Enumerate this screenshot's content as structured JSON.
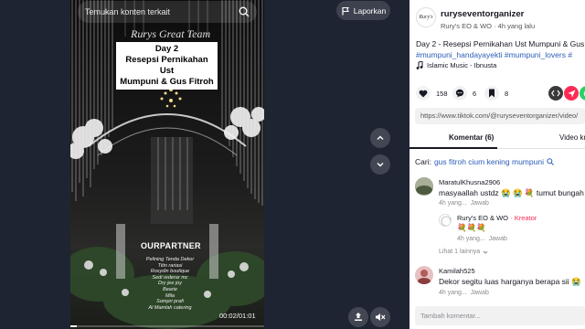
{
  "search": {
    "placeholder": "Temukan konten terkait"
  },
  "report": {
    "label": "Laporkan"
  },
  "video": {
    "brand_overlay": "Rurys Great Team",
    "caption_lines": [
      "Day 2",
      "Resepsi Pernikahan Ust",
      "Mumpuni & Gus Fitroh"
    ],
    "partner_title": "OURPARTNER",
    "partner_credits": [
      "Pelining Tenda Dekor",
      "Titin rariasi",
      "Rosydin boutique",
      "Sedi rederar mc",
      "Dry jee joy",
      "Bearie",
      "Mila",
      "Sompri prafi",
      "Al Mamlah catering"
    ],
    "timecode": "00:02/01:01",
    "progress": 0.033
  },
  "author": {
    "avatar_text": "Rury's",
    "username": "ruryseventorganizer",
    "display_line": "Rury's EO & WO · 4h yang lalu"
  },
  "post": {
    "description": "Day 2 - Resepsi Pernikahan Ust Mumpuni & Gus Fitroh",
    "hashtags": "#mumpuni_handayayekti #mumpuni_lovers #",
    "music": "Islamic Music - Ibnusta"
  },
  "stats": {
    "likes": "158",
    "comments": "6",
    "saves": "8"
  },
  "share_link": "https://www.tiktok.com/@ruryseventorganizer/video/",
  "tabs": [
    {
      "label": "Komentar (6)"
    },
    {
      "label": "Video kreator"
    }
  ],
  "related_search": {
    "prefix": "Cari:",
    "query": "gus fitroh cium kening mumpuni"
  },
  "comments": [
    {
      "name": "MaratulKhusna2906",
      "text": "masyaallah ustdz 😭 😭 💐 tumut bungah",
      "time": "4h yang...",
      "reply": "Jawab",
      "replies": [
        {
          "name": "Rury's EO & WO",
          "badge": "· Kreator",
          "text": "💐💐💐",
          "time": "4h yang...",
          "reply": "Jawab"
        }
      ],
      "more": "Lihat 1 lainnya"
    },
    {
      "name": "Kamilah525",
      "text": "Dekor segitu luas harganya berapa sii 😭",
      "time": "4h yang...",
      "reply": "Jawab"
    }
  ],
  "comment_input": {
    "placeholder": "Tambah komentar..."
  },
  "colors": {
    "stage_bg": "#1f2433",
    "hashtag": "#2b5db9",
    "kreator": "#fe2c55",
    "like_btn": "#f1f1f2"
  }
}
